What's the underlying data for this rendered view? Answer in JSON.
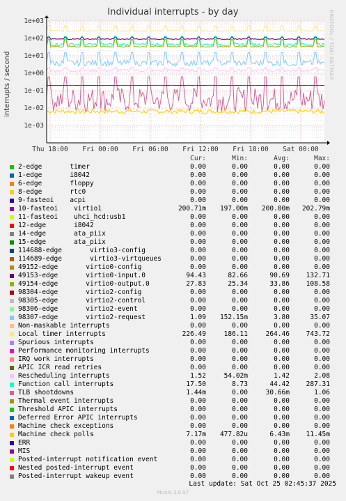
{
  "title": "Individual interrupts - by day",
  "watermark": "RRDTOOL / TOBI OETIKER",
  "footer": "Munin 2.0.57",
  "last_update": "Last update: Sat Oct 25 02:45:37 2025",
  "legend_headers": {
    "cur": "Cur:",
    "min": "Min:",
    "avg": "Avg:",
    "max": "Max:"
  },
  "chart_data": {
    "type": "line",
    "title": "Individual interrupts - by day",
    "ylabel": "interrupts / second",
    "yscale": "log",
    "ylim": [
      0.0001,
      1000
    ],
    "y_ticks": [
      "1e+03",
      "1e+02",
      "1e+01",
      "1e+00",
      "1e-01",
      "1e-02",
      "1e-03"
    ],
    "x_ticks": [
      "Thu 18:00",
      "Fri 00:00",
      "Fri 06:00",
      "Fri 12:00",
      "Fri 18:00",
      "Sat 00:00"
    ],
    "grid": true,
    "legend_position": "bottom",
    "series": [
      {
        "name": "2-edge       timer",
        "color": "#00cc00",
        "cur": "0.00",
        "min": "0.00",
        "avg": "0.00",
        "max": "0.00"
      },
      {
        "name": "1-edge       i8042",
        "color": "#0066b3",
        "cur": "0.00",
        "min": "0.00",
        "avg": "0.00",
        "max": "0.00"
      },
      {
        "name": "6-edge       floppy",
        "color": "#ff8000",
        "cur": "0.00",
        "min": "0.00",
        "avg": "0.00",
        "max": "0.00"
      },
      {
        "name": "8-edge       rtc0",
        "color": "#ffcc00",
        "cur": "0.00",
        "min": "0.00",
        "avg": "0.00",
        "max": "0.00"
      },
      {
        "name": "9-fasteoi    acpi",
        "color": "#330099",
        "cur": "0.00",
        "min": "0.00",
        "avg": "0.00",
        "max": "0.00"
      },
      {
        "name": "10-fasteoi    virtio1",
        "color": "#990099",
        "cur": "200.71m",
        "min": "197.00m",
        "avg": "200.00m",
        "max": "202.79m"
      },
      {
        "name": "11-fasteoi    uhci_hcd:usb1",
        "color": "#ccff00",
        "cur": "0.00",
        "min": "0.00",
        "avg": "0.00",
        "max": "0.00"
      },
      {
        "name": "12-edge       i8042",
        "color": "#ff0000",
        "cur": "0.00",
        "min": "0.00",
        "avg": "0.00",
        "max": "0.00"
      },
      {
        "name": "14-edge       ata_piix",
        "color": "#808080",
        "cur": "0.00",
        "min": "0.00",
        "avg": "0.00",
        "max": "0.00"
      },
      {
        "name": "15-edge       ata_piix",
        "color": "#008f00",
        "cur": "0.00",
        "min": "0.00",
        "avg": "0.00",
        "max": "0.00"
      },
      {
        "name": "114688-edge       virtio3-config",
        "color": "#00487d",
        "cur": "0.00",
        "min": "0.00",
        "avg": "0.00",
        "max": "0.00"
      },
      {
        "name": "114689-edge       virtio3-virtqueues",
        "color": "#b35a00",
        "cur": "0.00",
        "min": "0.00",
        "avg": "0.00",
        "max": "0.00"
      },
      {
        "name": "49152-edge       virtio0-config",
        "color": "#b38f00",
        "cur": "0.00",
        "min": "0.00",
        "avg": "0.00",
        "max": "0.00"
      },
      {
        "name": "49153-edge       virtio0-input.0",
        "color": "#6b006b",
        "cur": "94.43",
        "min": "82.66",
        "avg": "90.69",
        "max": "132.71"
      },
      {
        "name": "49154-edge       virtio0-output.0",
        "color": "#8fb300",
        "cur": "27.83",
        "min": "25.34",
        "avg": "33.86",
        "max": "108.58"
      },
      {
        "name": "98304-edge       virtio2-config",
        "color": "#b30000",
        "cur": "0.00",
        "min": "0.00",
        "avg": "0.00",
        "max": "0.00"
      },
      {
        "name": "98305-edge       virtio2-control",
        "color": "#bebebe",
        "cur": "0.00",
        "min": "0.00",
        "avg": "0.00",
        "max": "0.00"
      },
      {
        "name": "98306-edge       virtio2-event",
        "color": "#80ff80",
        "cur": "0.00",
        "min": "0.00",
        "avg": "0.00",
        "max": "0.00"
      },
      {
        "name": "98307-edge       virtio2-request",
        "color": "#80c9ff",
        "cur": "1.09",
        "min": "152.15m",
        "avg": "3.80",
        "max": "35.07"
      },
      {
        "name": "Non-maskable interrupts",
        "color": "#ffc080",
        "cur": "0.00",
        "min": "0.00",
        "avg": "0.00",
        "max": "0.00"
      },
      {
        "name": "Local timer interrupts",
        "color": "#ffe680",
        "cur": "226.49",
        "min": "186.11",
        "avg": "264.46",
        "max": "743.72"
      },
      {
        "name": "Spurious interrupts",
        "color": "#aa80ff",
        "cur": "0.00",
        "min": "0.00",
        "avg": "0.00",
        "max": "0.00"
      },
      {
        "name": "Performance monitoring interrupts",
        "color": "#ee00cc",
        "cur": "0.00",
        "min": "0.00",
        "avg": "0.00",
        "max": "0.00"
      },
      {
        "name": "IRQ work interrupts",
        "color": "#ff8080",
        "cur": "0.00",
        "min": "0.00",
        "avg": "0.00",
        "max": "0.00"
      },
      {
        "name": "APIC ICR read retries",
        "color": "#666600",
        "cur": "0.00",
        "min": "0.00",
        "avg": "0.00",
        "max": "0.00"
      },
      {
        "name": "Rescheduling interrupts",
        "color": "#ffbfff",
        "cur": "1.52",
        "min": "54.02m",
        "avg": "1.42",
        "max": "2.08"
      },
      {
        "name": "Function call interrupts",
        "color": "#00ffcc",
        "cur": "17.50",
        "min": "8.73",
        "avg": "44.42",
        "max": "287.31"
      },
      {
        "name": "TLB shootdowns",
        "color": "#cc6699",
        "cur": "1.44m",
        "min": "0.00",
        "avg": "30.66m",
        "max": "1.06"
      },
      {
        "name": "Thermal event interrupts",
        "color": "#999900",
        "cur": "0.00",
        "min": "0.00",
        "avg": "0.00",
        "max": "0.00"
      },
      {
        "name": "Threshold APIC interrupts",
        "color": "#00cc00",
        "cur": "0.00",
        "min": "0.00",
        "avg": "0.00",
        "max": "0.00"
      },
      {
        "name": "Deferred Error APIC interrupts",
        "color": "#0066b3",
        "cur": "0.00",
        "min": "0.00",
        "avg": "0.00",
        "max": "0.00"
      },
      {
        "name": "Machine check exceptions",
        "color": "#ff8000",
        "cur": "0.00",
        "min": "0.00",
        "avg": "0.00",
        "max": "0.00"
      },
      {
        "name": "Machine check polls",
        "color": "#ffcc00",
        "cur": "7.17m",
        "min": "477.82u",
        "avg": "6.43m",
        "max": "11.45m"
      },
      {
        "name": "ERR",
        "color": "#330099",
        "cur": "0.00",
        "min": "0.00",
        "avg": "0.00",
        "max": "0.00"
      },
      {
        "name": "MIS",
        "color": "#990099",
        "cur": "0.00",
        "min": "0.00",
        "avg": "0.00",
        "max": "0.00"
      },
      {
        "name": "Posted-interrupt notification event",
        "color": "#ccff00",
        "cur": "0.00",
        "min": "0.00",
        "avg": "0.00",
        "max": "0.00"
      },
      {
        "name": "Nested posted-interrupt event",
        "color": "#ff0000",
        "cur": "0.00",
        "min": "0.00",
        "avg": "0.00",
        "max": "0.00"
      },
      {
        "name": "Posted-interrupt wakeup event",
        "color": "#808080",
        "cur": "0.00",
        "min": "0.00",
        "avg": "0.00",
        "max": "0.00"
      }
    ]
  }
}
